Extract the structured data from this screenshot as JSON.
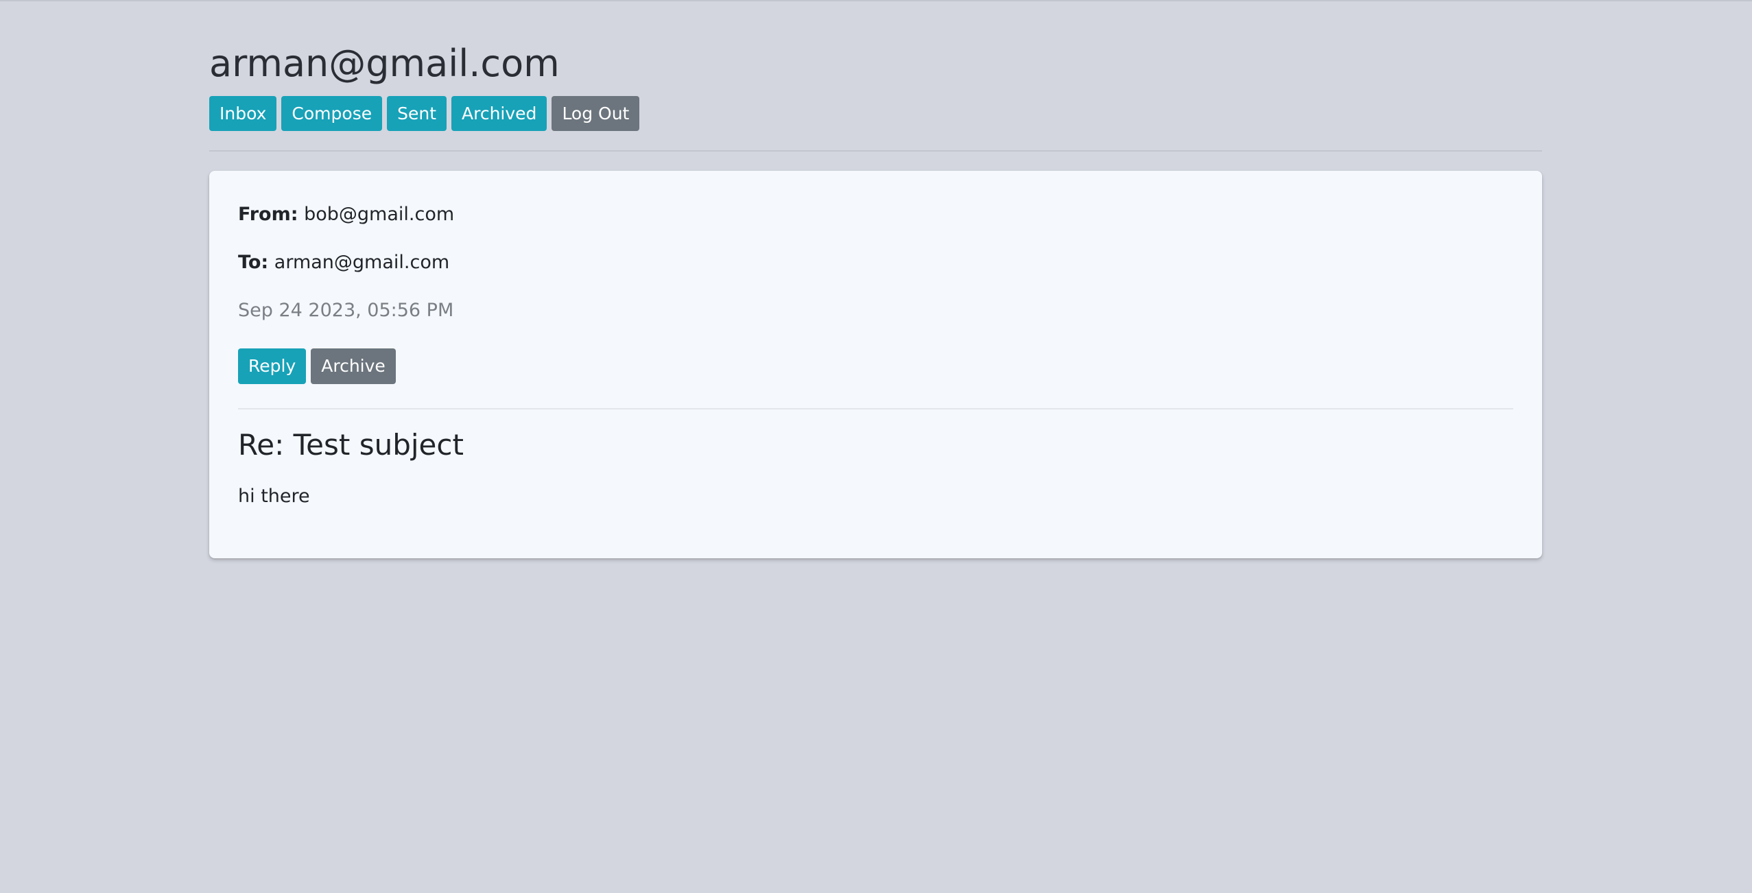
{
  "header": {
    "user_email": "arman@gmail.com"
  },
  "nav": {
    "inbox": "Inbox",
    "compose": "Compose",
    "sent": "Sent",
    "archived": "Archived",
    "logout": "Log Out"
  },
  "email": {
    "from_label": "From:",
    "from": "bob@gmail.com",
    "to_label": "To:",
    "to": "arman@gmail.com",
    "timestamp": "Sep 24 2023, 05:56 PM",
    "reply_label": "Reply",
    "archive_label": "Archive",
    "subject": "Re: Test subject",
    "body": "hi there"
  },
  "colors": {
    "background": "#d3d6df",
    "primary": "#17a2b8",
    "secondary": "#6c757d",
    "card": "#f5f8fc"
  }
}
